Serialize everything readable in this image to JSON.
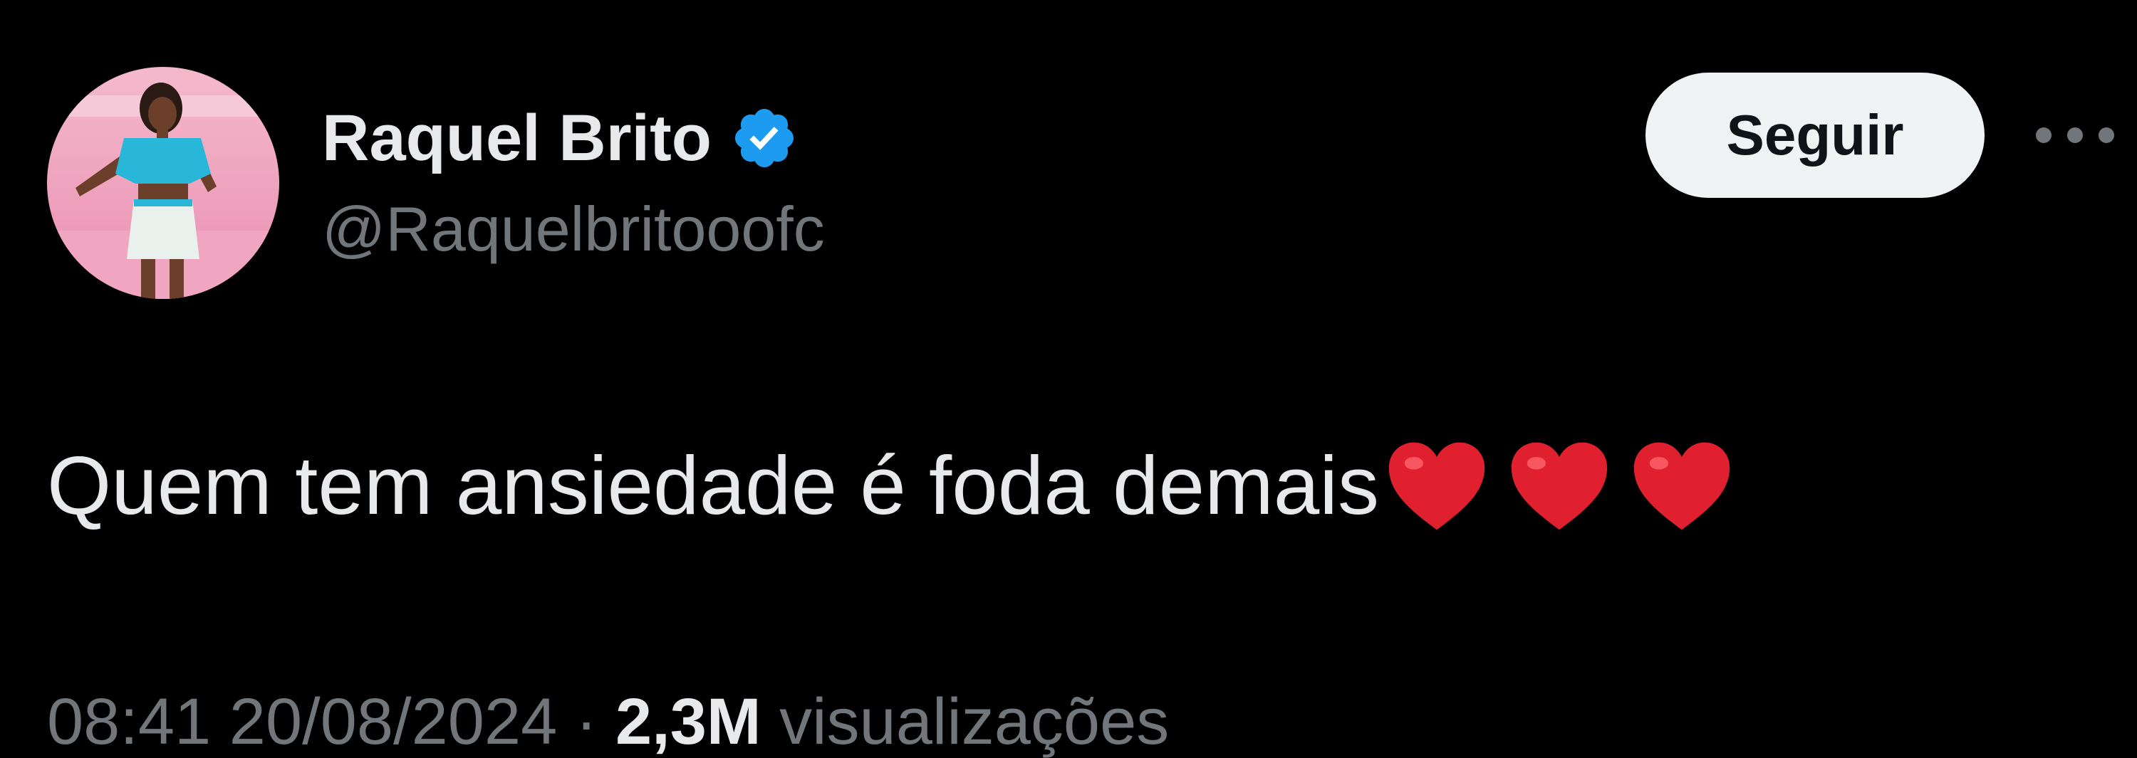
{
  "author": {
    "display_name": "Raquel Brito",
    "handle": "@Raquelbritooofc",
    "verified": true,
    "verified_color": "#1d9bf0"
  },
  "actions": {
    "follow_label": "Seguir",
    "more_icon": "more-horizontal-icon"
  },
  "tweet": {
    "text": "Quem tem ansiedade é foda demais",
    "emojis": [
      "red-heart-icon",
      "red-heart-icon",
      "red-heart-icon"
    ]
  },
  "meta": {
    "time": "08:41",
    "date": "20/08/2024",
    "separator": "·",
    "views": "2,3M",
    "views_label": "visualizações"
  },
  "colors": {
    "background": "#000000",
    "text_primary": "#e7e9ea",
    "text_secondary": "#71767b",
    "button_bg": "#eff3f4",
    "button_text": "#0f1419",
    "heart": "#e0202e"
  }
}
